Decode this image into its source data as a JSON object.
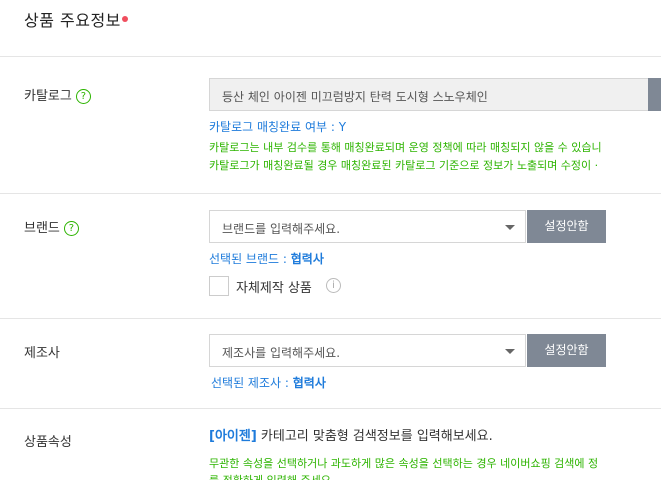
{
  "section": {
    "title": "상품 주요정보"
  },
  "catalog": {
    "label": "카탈로그",
    "help": "?",
    "value": "등산 체인 아이젠 미끄럼방지 탄력 도시형 스노우체인",
    "match_label": "카탈로그 매칭완료 여부 : Y",
    "note1": "카탈로그는 내부 검수를 통해 매칭완료되며 운영 정책에 따라 매칭되지 않을 수 있습니",
    "note2": "카탈로그가 매칭완료될 경우 매칭완료된 카탈로그 기준으로 정보가 노출되며 수정이 ·"
  },
  "brand": {
    "label": "브랜드",
    "help": "?",
    "placeholder": "브랜드를 입력해주세요.",
    "button": "설정안함",
    "selected_prefix": "선택된 브랜드 : ",
    "selected_value": "협력사",
    "checkbox_label": "자체제작 상품",
    "info": "i"
  },
  "maker": {
    "label": "제조사",
    "placeholder": "제조사를 입력해주세요.",
    "button": "설정안함",
    "selected_prefix": "선택된 제조사 : ",
    "selected_value": "협력사"
  },
  "attributes": {
    "label": "상품속성",
    "category": "[아이젠]",
    "text": " 카테고리 맞춤형 검색정보를 입력해보세요.",
    "note1": "무관한 속성을 선택하거나 과도하게 많은 속성을 선택하는 경우 네이버쇼핑 검색에 정",
    "note2": "를 정확하게 입력해 주세요."
  }
}
